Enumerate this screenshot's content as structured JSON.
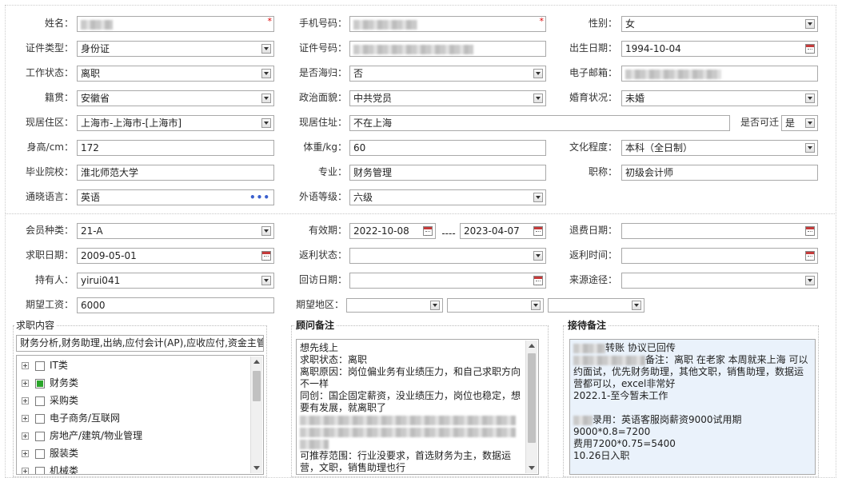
{
  "row1": {
    "name_label": "姓名：",
    "phone_label": "手机号码：",
    "gender_label": "性别：",
    "gender_value": "女",
    "required_mark": "*"
  },
  "row2": {
    "idtype_label": "证件类型：",
    "idtype_value": "身份证",
    "idno_label": "证件号码：",
    "birth_label": "出生日期：",
    "birth_value": "1994-10-04"
  },
  "row3": {
    "workstatus_label": "工作状态：",
    "workstatus_value": "离职",
    "returnee_label": "是否海归：",
    "returnee_value": "否",
    "email_label": "电子邮箱："
  },
  "row4": {
    "native_label": "籍贯：",
    "native_value": "安徽省",
    "political_label": "政治面貌：",
    "political_value": "中共党员",
    "marital_label": "婚育状况：",
    "marital_value": "未婚"
  },
  "row5": {
    "residence_label": "现居住区：",
    "residence_value": "上海市-上海市-[上海市]",
    "address_label": "现居住址：",
    "address_value": "不在上海",
    "relocate_label": "是否可迁",
    "relocate_value": "是"
  },
  "row6": {
    "height_label": "身高/cm：",
    "height_value": "172",
    "weight_label": "体重/kg：",
    "weight_value": "60",
    "education_label": "文化程度：",
    "education_value": "本科（全日制）"
  },
  "row7": {
    "school_label": "毕业院校：",
    "school_value": "淮北师范大学",
    "major_label": "专业：",
    "major_value": "财务管理",
    "title_label": "职称：",
    "title_value": "初级会计师"
  },
  "row8": {
    "language_label": "通晓语言：",
    "language_value": "英语",
    "langlevel_label": "外语等级：",
    "langlevel_value": "六级",
    "more_glyph": "•••"
  },
  "row9": {
    "member_label": "会员种类：",
    "member_value": "21-A",
    "valid_label": "有效期：",
    "valid_from": "2022-10-08",
    "valid_sep": "----",
    "valid_to": "2023-04-07",
    "refund_label": "退费日期："
  },
  "row10": {
    "jobdate_label": "求职日期：",
    "jobdate_value": "2009-05-01",
    "rebate_label": "返利状态：",
    "rebatetime_label": "返利时间："
  },
  "row11": {
    "holder_label": "持有人：",
    "holder_value": "yirui041",
    "visit_label": "回访日期：",
    "source_label": "来源途径："
  },
  "row12": {
    "salary_label": "期望工资：",
    "salary_value": "6000",
    "area_label": "期望地区："
  },
  "jobs": {
    "title": "求职内容",
    "summary": "财务分析,财务助理,出纳,应付会计(AP),应收应付,资金主管",
    "items": [
      {
        "label": "IT类",
        "checked": false
      },
      {
        "label": "财务类",
        "checked": true
      },
      {
        "label": "采购类",
        "checked": false
      },
      {
        "label": "电子商务/互联网",
        "checked": false
      },
      {
        "label": "房地产/建筑/物业管理",
        "checked": false
      },
      {
        "label": "服装类",
        "checked": false
      },
      {
        "label": "机械类",
        "checked": false
      }
    ]
  },
  "consultant": {
    "title": "顾问备注",
    "lines": [
      "想先线上",
      "求职状态：离职",
      "离职原因：岗位偏业务有业绩压力，和自己求职方向不一样",
      "同创：国企固定薪资，没业绩压力，岗位也稳定，想要有发展，就离职了",
      "可推荐范围：行业没要求，首选财务为主，数据运营，文职，销售助理也行"
    ]
  },
  "reception": {
    "title": "接待备注",
    "line1": "转账 协议已回传",
    "line2": "备注：离职 在老家 本周就来上海 可以约面试，优先财务助理，其他文职，销售助理，数据运营都可以，excel非常好",
    "line3": "2022.1-至今暂未工作",
    "line4": "录用：英语客服岗薪资9000试用期9000*0.8=7200",
    "line5": "费用7200*0.75=5400",
    "line6": "10.26日入职"
  },
  "icons": {
    "dropdown": "chevron-down-icon",
    "calendar": "calendar-icon",
    "more": "ellipsis-icon",
    "expand": "plus-icon"
  },
  "colors": {
    "required": "#dd0000",
    "checked": "#2aa52a",
    "reception_bg": "#eaf2fb"
  }
}
